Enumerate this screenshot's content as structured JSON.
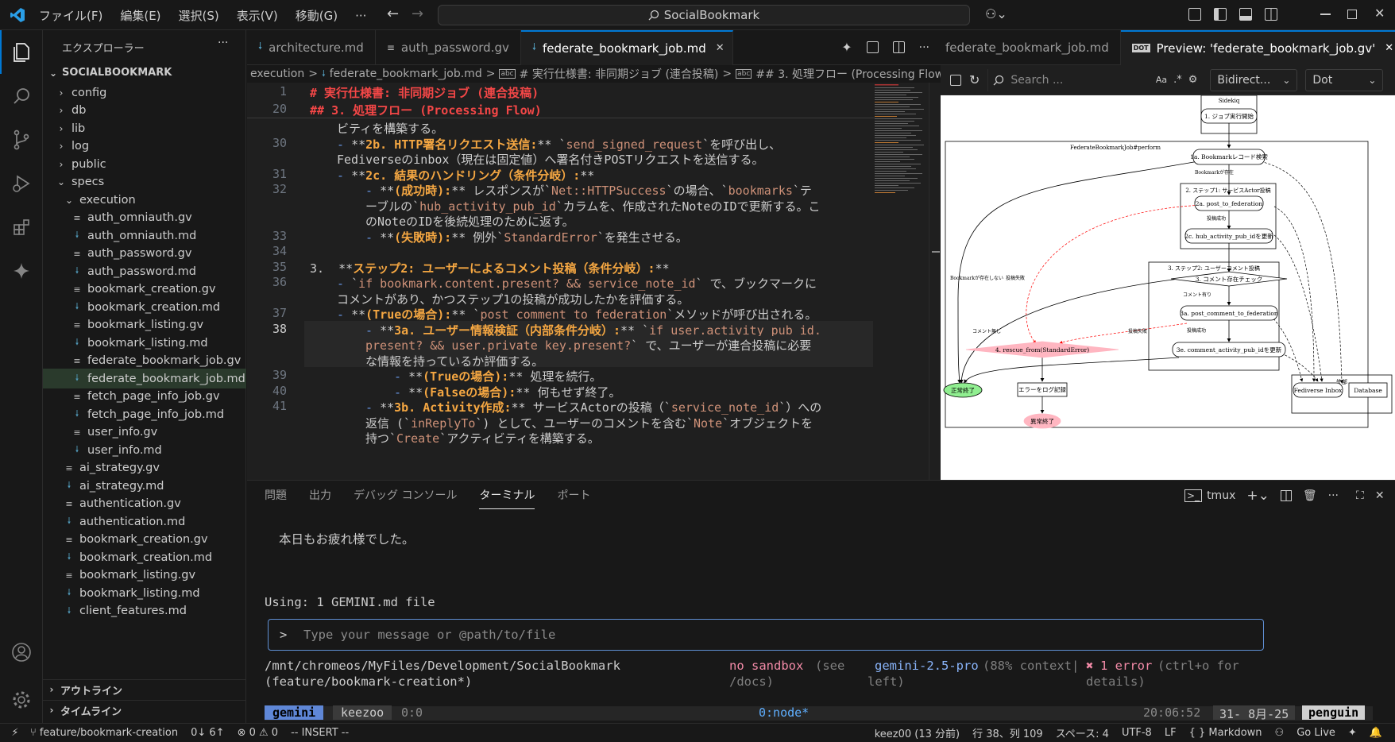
{
  "titlebar": {
    "menus": [
      "ファイル(F)",
      "編集(E)",
      "選択(S)",
      "表示(V)",
      "移動(G)",
      "···"
    ],
    "search": "SocialBookmark"
  },
  "sidebar": {
    "title": "エクスプローラー",
    "more": "···",
    "root": "SOCIALBOOKMARK",
    "items": [
      {
        "label": "config",
        "type": "folder",
        "depth": 1,
        "open": false
      },
      {
        "label": "db",
        "type": "folder",
        "depth": 1,
        "open": false
      },
      {
        "label": "lib",
        "type": "folder",
        "depth": 1,
        "open": false
      },
      {
        "label": "log",
        "type": "folder",
        "depth": 1,
        "open": false
      },
      {
        "label": "public",
        "type": "folder",
        "depth": 1,
        "open": false
      },
      {
        "label": "specs",
        "type": "folder",
        "depth": 1,
        "open": true
      },
      {
        "label": "execution",
        "type": "folder",
        "depth": 2,
        "open": true
      },
      {
        "label": "auth_omniauth.gv",
        "type": "gv",
        "depth": 3
      },
      {
        "label": "auth_omniauth.md",
        "type": "md",
        "depth": 3
      },
      {
        "label": "auth_password.gv",
        "type": "gv",
        "depth": 3
      },
      {
        "label": "auth_password.md",
        "type": "md",
        "depth": 3
      },
      {
        "label": "bookmark_creation.gv",
        "type": "gv",
        "depth": 3
      },
      {
        "label": "bookmark_creation.md",
        "type": "md",
        "depth": 3
      },
      {
        "label": "bookmark_listing.gv",
        "type": "gv",
        "depth": 3
      },
      {
        "label": "bookmark_listing.md",
        "type": "md",
        "depth": 3
      },
      {
        "label": "federate_bookmark_job.gv",
        "type": "gv",
        "depth": 3
      },
      {
        "label": "federate_bookmark_job.md",
        "type": "md",
        "depth": 3,
        "selected": true
      },
      {
        "label": "fetch_page_info_job.gv",
        "type": "gv",
        "depth": 3
      },
      {
        "label": "fetch_page_info_job.md",
        "type": "md",
        "depth": 3
      },
      {
        "label": "user_info.gv",
        "type": "gv",
        "depth": 3
      },
      {
        "label": "user_info.md",
        "type": "md",
        "depth": 3
      },
      {
        "label": "ai_strategy.gv",
        "type": "gv",
        "depth": 2
      },
      {
        "label": "ai_strategy.md",
        "type": "md",
        "depth": 2
      },
      {
        "label": "authentication.gv",
        "type": "gv",
        "depth": 2
      },
      {
        "label": "authentication.md",
        "type": "md",
        "depth": 2
      },
      {
        "label": "bookmark_creation.gv",
        "type": "gv",
        "depth": 2
      },
      {
        "label": "bookmark_creation.md",
        "type": "md",
        "depth": 2
      },
      {
        "label": "bookmark_listing.gv",
        "type": "gv",
        "depth": 2
      },
      {
        "label": "bookmark_listing.md",
        "type": "md",
        "depth": 2
      },
      {
        "label": "client_features.md",
        "type": "md",
        "depth": 2
      }
    ],
    "outline": "アウトライン",
    "timeline": "タイムライン"
  },
  "tabs": [
    {
      "label": "architecture.md",
      "icon": "md"
    },
    {
      "label": "auth_password.gv",
      "icon": "gv"
    },
    {
      "label": "federate_bookmark_job.md",
      "icon": "md",
      "active": true
    }
  ],
  "tab_close": "✕",
  "breadcrumb": [
    "execution",
    ">",
    "federate_bookmark_job.md",
    ">",
    "# 実行仕様書: 非同期ジョブ (連合投稿)",
    ">",
    "## 3. 処理フロー (Processing Flow)"
  ],
  "editor": {
    "sticky": [
      {
        "ln": "1",
        "text": "# 実行仕様書: 非同期ジョブ (連合投稿)"
      },
      {
        "ln": "20",
        "text": "## 3. 処理フロー (Processing Flow)"
      }
    ],
    "lines": [
      {
        "ln": "",
        "segs": [
          [
            "",
            "ビティを構築する。"
          ]
        ],
        "indent": 1
      },
      {
        "ln": "30",
        "segs": [
          [
            "dash",
            "- "
          ],
          [
            "",
            "**"
          ],
          [
            "k",
            "2b. HTTP署名リクエスト送信:"
          ],
          [
            "",
            "** `"
          ],
          [
            "cd",
            "send_signed_request"
          ],
          [
            "",
            "`を呼び出し、"
          ]
        ],
        "indent": 1
      },
      {
        "ln": "",
        "segs": [
          [
            "",
            "Fediverseのinbox（現在は固定値）へ署名付きPOSTリクエストを送信する。"
          ]
        ],
        "indent": 1
      },
      {
        "ln": "31",
        "segs": [
          [
            "dash",
            "- "
          ],
          [
            "",
            "**"
          ],
          [
            "k",
            "2c. 結果のハンドリング（条件分岐）:"
          ],
          [
            "",
            "**"
          ]
        ],
        "indent": 1
      },
      {
        "ln": "32",
        "segs": [
          [
            "dash",
            "- "
          ],
          [
            "",
            "**"
          ],
          [
            "k",
            "(成功時):"
          ],
          [
            "",
            "** レスポンスが`"
          ],
          [
            "cd",
            "Net::HTTPSuccess"
          ],
          [
            "",
            "`の場合、`"
          ],
          [
            "cd",
            "bookmarks"
          ],
          [
            "",
            "`テ"
          ]
        ],
        "indent": 2
      },
      {
        "ln": "",
        "segs": [
          [
            "",
            "ーブルの`"
          ],
          [
            "cd",
            "hub_activity_pub_id"
          ],
          [
            "",
            "`カラムを、作成されたNoteのIDで更新する。こ"
          ]
        ],
        "indent": 2
      },
      {
        "ln": "",
        "segs": [
          [
            "",
            "のNoteのIDを後続処理のために返す。"
          ]
        ],
        "indent": 2
      },
      {
        "ln": "33",
        "segs": [
          [
            "dash",
            "- "
          ],
          [
            "",
            "**"
          ],
          [
            "k",
            "(失敗時):"
          ],
          [
            "",
            "** 例外`"
          ],
          [
            "cd",
            "StandardError"
          ],
          [
            "",
            "`を発生させる。"
          ]
        ],
        "indent": 2
      },
      {
        "ln": "34",
        "segs": [
          [
            "",
            ""
          ]
        ],
        "indent": 0
      },
      {
        "ln": "35",
        "segs": [
          [
            "",
            "3.  **"
          ],
          [
            "k",
            "ステップ2: ユーザーによるコメント投稿（条件分岐）:"
          ],
          [
            "",
            "**"
          ]
        ],
        "indent": 0
      },
      {
        "ln": "36",
        "segs": [
          [
            "dash",
            "- "
          ],
          [
            "",
            "`"
          ],
          [
            "cd",
            "if bookmark.content.present? && service_note_id"
          ],
          [
            "",
            "` で、ブックマークに"
          ]
        ],
        "indent": 1
      },
      {
        "ln": "",
        "segs": [
          [
            "",
            "コメントがあり、かつステップ1の投稿が成功したかを評価する。"
          ]
        ],
        "indent": 1
      },
      {
        "ln": "37",
        "segs": [
          [
            "dash",
            "- "
          ],
          [
            "",
            "**"
          ],
          [
            "k",
            "(Trueの場合):"
          ],
          [
            "",
            "** `"
          ],
          [
            "cd",
            "post_comment_to_federation"
          ],
          [
            "",
            "`メソッドが呼び出される。"
          ]
        ],
        "indent": 1
      },
      {
        "ln": "38",
        "segs": [
          [
            "dash",
            "- "
          ],
          [
            "",
            "**"
          ],
          [
            "k",
            "3a. ユーザー情報検証（内部条件分岐）:"
          ],
          [
            "",
            "** `"
          ],
          [
            "cd",
            "if user.activity_pub_id."
          ]
        ],
        "indent": 2,
        "cur": true
      },
      {
        "ln": "",
        "segs": [
          [
            "cd",
            "present? && user.private_key.present?"
          ],
          [
            "",
            "` で、ユーザーが連合投稿に必要"
          ]
        ],
        "indent": 2,
        "cur": true
      },
      {
        "ln": "",
        "segs": [
          [
            "",
            "な情報を持っているか評価する。"
          ]
        ],
        "indent": 2,
        "cur": true
      },
      {
        "ln": "39",
        "segs": [
          [
            "dash",
            "- "
          ],
          [
            "",
            "**"
          ],
          [
            "k",
            "(Trueの場合):"
          ],
          [
            "",
            "** 処理を続行。"
          ]
        ],
        "indent": 3
      },
      {
        "ln": "40",
        "segs": [
          [
            "dash",
            "- "
          ],
          [
            "",
            "**"
          ],
          [
            "k",
            "(Falseの場合):"
          ],
          [
            "",
            "** 何もせず終了。"
          ]
        ],
        "indent": 3
      },
      {
        "ln": "41",
        "segs": [
          [
            "dash",
            "- "
          ],
          [
            "",
            "**"
          ],
          [
            "k",
            "3b. Activity作成:"
          ],
          [
            "",
            "** サービスActorの投稿（`"
          ],
          [
            "cd",
            "service_note_id"
          ],
          [
            "",
            "`）への"
          ]
        ],
        "indent": 2
      },
      {
        "ln": "",
        "segs": [
          [
            "",
            "返信 (`"
          ],
          [
            "cd",
            "inReplyTo"
          ],
          [
            "",
            "`) として、ユーザーのコメントを含む`"
          ],
          [
            "cd",
            "Note"
          ],
          [
            "",
            "`オブジェクトを"
          ]
        ],
        "indent": 2
      },
      {
        "ln": "",
        "segs": [
          [
            "",
            "持つ`"
          ],
          [
            "cd",
            "Create"
          ],
          [
            "",
            "`アクティビティを構築する。"
          ]
        ],
        "indent": 2
      }
    ]
  },
  "preview": {
    "tab_left": "federate_bookmark_job.md",
    "tab_label": "Preview: 'federate_bookmark_job.gv'",
    "tab_icon_text": "DOT",
    "search_placeholder": "Search ...",
    "aa": "Aa",
    "direction": "Bidirect...",
    "engine": "Dot",
    "graph": {
      "cluster_sidekiq": "Sidekiq",
      "n_start": "1. ジョブ実行開始",
      "cluster_perform": "FederateBookmarkJob#perform",
      "n_find": "1a. Bookmarkレコード検索",
      "e_exists": "Bookmarkが存在",
      "cluster_step1": "2. ステップ1: サービスActor投稿",
      "n_post": "2a. post_to_federation",
      "e_ok1": "投稿成功",
      "n_hub": "2c. hub_activity_pub_idを更新",
      "cluster_step2": "3. ステップ2: ユーザーコメント投稿",
      "n_check": "3. コメント存在チェック",
      "e_has": "コメント有り",
      "n_postc": "3a. post_comment_to_federation",
      "e_ok2": "投稿成功",
      "n_upd": "3e. comment_activity_pub_idを更新",
      "n_rescue": "4. rescue_from(StandardError)",
      "n_log": "エラーをログ記録",
      "n_ok": "正常終了",
      "n_ng": "異常終了",
      "e_missing": "Bookmarkが存在しない",
      "e_fail1": "投稿失敗",
      "e_none": "コメント無し",
      "e_fail2": "投稿失敗",
      "cluster_ext": "外部",
      "n_inbox": "Fediverse Inbox",
      "n_db": "Database"
    }
  },
  "panel": {
    "tabs": [
      "問題",
      "出力",
      "デバッグ コンソール",
      "ターミナル",
      "ポート"
    ],
    "active": "ターミナル",
    "shell": "tmux",
    "terminal": {
      "greeting": "本日もお疲れ様でした。",
      "using": "Using: 1 GEMINI.md file",
      "prompt": ">",
      "placeholder": "Type your message or @path/to/file",
      "path1": "/mnt/chromeos/MyFiles/Development/SocialBookmark",
      "path2": "(feature/bookmark-creation*)",
      "sandbox1": "no sandbox",
      "sandbox_hint1": "(see",
      "sandbox2": "/docs)",
      "model": "gemini-2.5-pro",
      "model_ctx": "(88% context|",
      "model2": "left)",
      "err_icon": "✖",
      "err": "1 error",
      "err_hint": "(ctrl+o for",
      "err2": "details)",
      "tmux_left1": "gemini",
      "tmux_left2": "keezoo",
      "tmux_left3": "0:0",
      "tmux_win": "0:node*",
      "tmux_time": "20:06:52",
      "tmux_date": "31- 8月-25",
      "tmux_host": "penguin"
    }
  },
  "status": {
    "branch": "feature/bookmark-creation",
    "sync": "0↓ 6↑",
    "problems": "⊗ 0 ⚠ 0",
    "mode": "-- INSERT --",
    "author": "keez00 (13 分前)",
    "position": "行 38、列 109",
    "spaces": "スペース: 4",
    "encoding": "UTF-8",
    "eol": "LF",
    "lang": "{ } Markdown",
    "golive": "Go Live"
  },
  "colors": {
    "accent": "#0078d4",
    "selected": "#2a3a2c",
    "graph_ok": "#90ee90",
    "graph_ng": "#ffb6c1",
    "md_icon": "#519aba",
    "tmux_green": "#005f87"
  }
}
